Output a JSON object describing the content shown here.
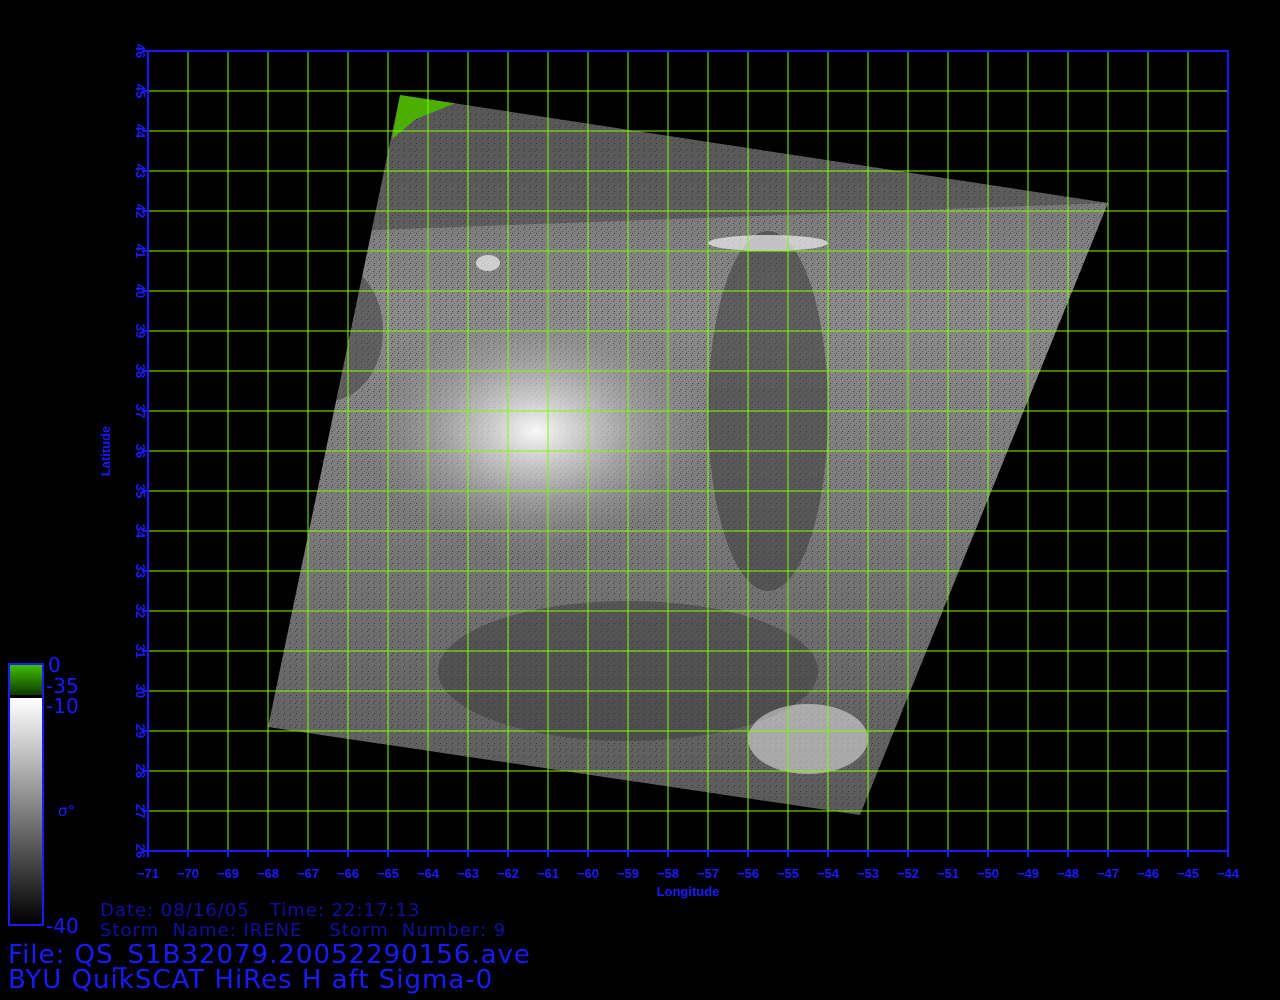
{
  "map": {
    "lon_range": [
      -71,
      -44
    ],
    "lat_range": [
      26,
      46
    ],
    "lon_ticks": [
      -71,
      -70,
      -69,
      -68,
      -67,
      -66,
      -65,
      -64,
      -63,
      -62,
      -61,
      -60,
      -59,
      -58,
      -57,
      -56,
      -55,
      -54,
      -53,
      -52,
      -51,
      -50,
      -49,
      -48,
      -47,
      -46,
      -45,
      -44
    ],
    "lat_ticks": [
      26,
      27,
      28,
      29,
      30,
      31,
      32,
      33,
      34,
      35,
      36,
      37,
      38,
      39,
      40,
      41,
      42,
      43,
      44,
      45,
      46
    ],
    "xlabel": "Longitude",
    "ylabel": "Latitude",
    "swath_corners_lonlat": [
      [
        -64.7,
        44.9
      ],
      [
        -47.0,
        42.2
      ],
      [
        -53.2,
        26.9
      ],
      [
        -68.0,
        29.1
      ]
    ],
    "eye_center_lonlat": [
      -61.3,
      36.5
    ],
    "grid_color": "#7cfc00",
    "frame_color": "#1a1aff"
  },
  "colorbar": {
    "labels": {
      "top": "0",
      "green_bottom": "-35",
      "gray_top": "-10",
      "bottom": "-40",
      "symbol": "σ°"
    },
    "colors": {
      "green": "#3fbf00",
      "gray_top": "#ffffff",
      "gray_bottom": "#000000"
    }
  },
  "info": {
    "date_line": "Date: 08/16/05   Time: 22:17:13",
    "storm_line": "Storm  Name: IRENE    Storm  Number: 9",
    "file_line": "File: QS_S1B32079.20052290156.ave",
    "title_line": "BYU QuikSCAT HiRes H aft Sigma-0"
  }
}
